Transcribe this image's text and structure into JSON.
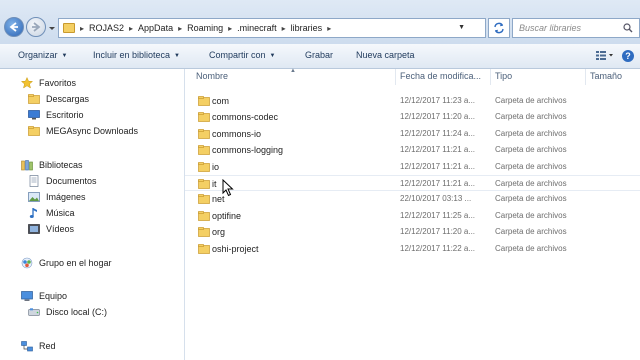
{
  "address": {
    "crumbs": [
      "ROJAS2",
      "AppData",
      "Roaming",
      ".minecraft",
      "libraries"
    ],
    "search_placeholder": "Buscar libraries"
  },
  "toolbar": {
    "organize": "Organizar",
    "include_library": "Incluir en biblioteca",
    "share_with": "Compartir con",
    "burn": "Grabar",
    "new_folder": "Nueva carpeta"
  },
  "nav": {
    "favorites": "Favoritos",
    "downloads": "Descargas",
    "desktop": "Escritorio",
    "mega": "MEGAsync Downloads",
    "libraries": "Bibliotecas",
    "documents": "Documentos",
    "pictures": "Imágenes",
    "music": "Música",
    "videos": "Vídeos",
    "homegroup": "Grupo en el hogar",
    "computer": "Equipo",
    "local_disk": "Disco local (C:)",
    "network": "Red"
  },
  "columns": {
    "name": "Nombre",
    "date": "Fecha de modifica...",
    "type": "Tipo",
    "size": "Tamaño"
  },
  "files": [
    {
      "name": "com",
      "date": "12/12/2017 11:23 a...",
      "type": "Carpeta de archivos"
    },
    {
      "name": "commons-codec",
      "date": "12/12/2017 11:20 a...",
      "type": "Carpeta de archivos"
    },
    {
      "name": "commons-io",
      "date": "12/12/2017 11:24 a...",
      "type": "Carpeta de archivos"
    },
    {
      "name": "commons-logging",
      "date": "12/12/2017 11:21 a...",
      "type": "Carpeta de archivos"
    },
    {
      "name": "io",
      "date": "12/12/2017 11:21 a...",
      "type": "Carpeta de archivos"
    },
    {
      "name": "it",
      "date": "12/12/2017 11:21 a...",
      "type": "Carpeta de archivos"
    },
    {
      "name": "net",
      "date": "22/10/2017 03:13 ...",
      "type": "Carpeta de archivos"
    },
    {
      "name": "optifine",
      "date": "12/12/2017 11:25 a...",
      "type": "Carpeta de archivos"
    },
    {
      "name": "org",
      "date": "12/12/2017 11:20 a...",
      "type": "Carpeta de archivos"
    },
    {
      "name": "oshi-project",
      "date": "12/12/2017 11:22 a...",
      "type": "Carpeta de archivos"
    }
  ],
  "colors": {
    "folder": "#f4cf63",
    "folder_border": "#c99a2e",
    "toolbar_text": "#1e395b",
    "accent": "#2b63b4"
  }
}
